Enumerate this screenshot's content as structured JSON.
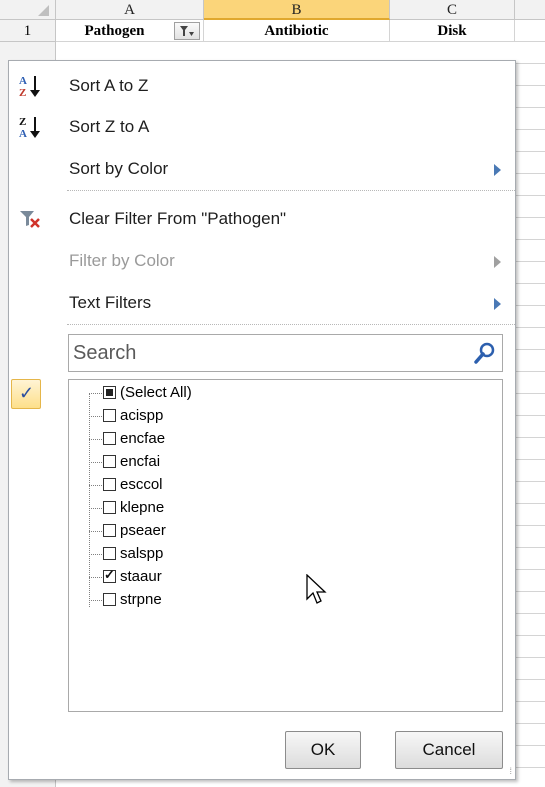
{
  "sheet": {
    "columns": [
      "A",
      "B",
      "C"
    ],
    "row_number": "1",
    "headers": [
      "Pathogen",
      "Antibiotic",
      "Disk"
    ]
  },
  "menu": {
    "sort_az": "Sort A to Z",
    "sort_za": "Sort Z to A",
    "sort_by_color": "Sort by Color",
    "clear_filter": "Clear Filter From \"Pathogen\"",
    "filter_by_color": "Filter by Color",
    "text_filters": "Text Filters",
    "search_placeholder": "Search",
    "items": [
      {
        "label": "(Select All)",
        "state": "partial"
      },
      {
        "label": "acispp",
        "state": "unchecked"
      },
      {
        "label": "encfae",
        "state": "unchecked"
      },
      {
        "label": "encfai",
        "state": "unchecked"
      },
      {
        "label": "esccol",
        "state": "unchecked"
      },
      {
        "label": "klepne",
        "state": "unchecked"
      },
      {
        "label": "pseaer",
        "state": "unchecked"
      },
      {
        "label": "salspp",
        "state": "unchecked"
      },
      {
        "label": "staaur",
        "state": "checked"
      },
      {
        "label": "strpne",
        "state": "unchecked"
      }
    ],
    "ok_label": "OK",
    "cancel_label": "Cancel",
    "checkmark": "✓"
  },
  "icons": {
    "sort_az": "sort-ascending-icon",
    "sort_za": "sort-descending-icon",
    "clear_filter": "clear-filter-icon",
    "filter_button": "filter-dropdown-icon",
    "search": "search-icon"
  },
  "colors": {
    "selected_column": "#fbd57a",
    "accent_arrow": "#4a79b5"
  }
}
